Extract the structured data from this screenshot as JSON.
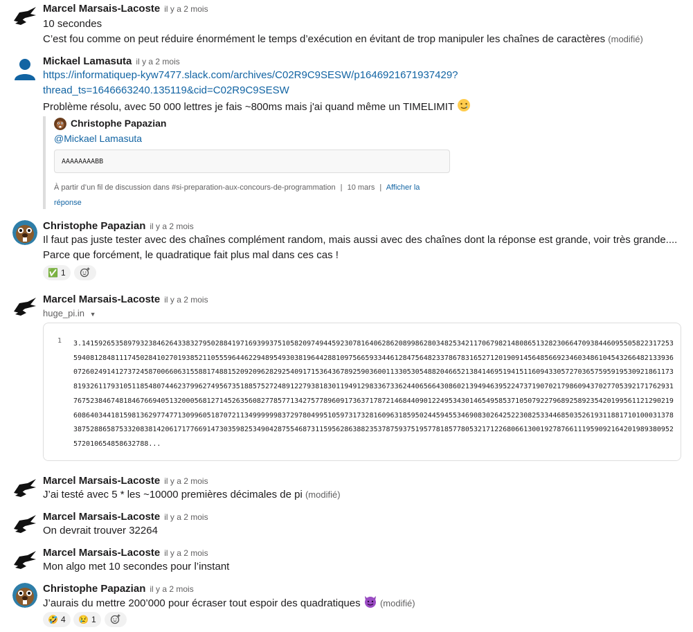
{
  "messages": [
    {
      "author": "Marcel Marsais-Lacoste",
      "time": "il y a 2 mois",
      "lines": [
        "10 secondes",
        "C’est fou comme on peut réduire énormément le temps d’exécution en évitant de trop manipuler les chaînes de caractères"
      ],
      "edited": "(modifié)"
    },
    {
      "author": "Mickael Lamasuta",
      "time": "il y a 2 mois",
      "link_line1": "https://informatiquep-kyw7477.slack.com/archives/C02R9C9SESW/p1646921671937429?",
      "link_line2": "thread_ts=1646663240.135119&cid=C02R9C9SESW",
      "text": "Problème résolu, avec 50 000 lettres je fais ~800ms mais j'ai quand même un TIMELIMIT",
      "quote": {
        "author": "Christophe Papazian",
        "mention": "@Mickael Lamasuta",
        "code": "AAAAAAAABB",
        "footer_prefix": "À partir d’un fil de discussion dans #si-preparation-aux-concours-de-programmation",
        "footer_sep": "|",
        "footer_date": "10 mars",
        "footer_link": "Afficher la",
        "footer_link2": "réponse"
      }
    },
    {
      "author": "Christophe Papazian",
      "time": "il y a 2 mois",
      "lines": [
        "Il faut pas juste tester avec des chaînes complément random, mais aussi avec des chaînes dont la réponse est grande, voir très grande....",
        "Parce que forcément, le quadratique fait plus mal dans ces cas !"
      ],
      "reactions": [
        {
          "emoji": "✅",
          "count": "1"
        }
      ]
    },
    {
      "author": "Marcel Marsais-Lacoste",
      "time": "il y a 2 mois",
      "file_name": "huge_pi.in",
      "file_line_number": "1",
      "file_content": "3.1415926535897932384626433832795028841971693993751058209749445923078164062862089986280348253421170679821480865132823066470938446095505822317253594081284811174502841027019385211055596446229489549303819644288109756659334461284756482337867831652712019091456485669234603486104543266482133936072602491412737245870066063155881748815209209628292540917153643678925903600113305305488204665213841469519415116094330572703657595919530921861173819326117931051185480744623799627495673518857527248912279381830119491298336733624406566430860213949463952247371907021798609437027705392171762931767523846748184676694051320005681271452635608277857713427577896091736371787214684409012249534301465495853710507922796892589235420199561121290219608640344181598136297747713099605187072113499999983729780499510597317328160963185950244594553469083026425223082533446850352619311881710100031378387528865875332083814206171776691473035982534904287554687311595628638823537875937519577818577805321712268066130019278766111959092164201989380952572010654858632788..."
    },
    {
      "author": "Marcel Marsais-Lacoste",
      "time": "il y a 2 mois",
      "lines": [
        "J’ai testé avec 5 * les ~10000 premières décimales de pi"
      ],
      "edited": "(modifié)"
    },
    {
      "author": "Marcel Marsais-Lacoste",
      "time": "il y a 2 mois",
      "lines": [
        "On devrait trouver 32264"
      ]
    },
    {
      "author": "Marcel Marsais-Lacoste",
      "time": "il y a 2 mois",
      "lines": [
        "Mon algo met 10 secondes pour l’instant"
      ]
    },
    {
      "author": "Christophe Papazian",
      "time": "il y a 2 mois",
      "lines": [
        "J’aurais du mettre 200’000 pour écraser tout espoir des quadratiques"
      ],
      "edited": "(modifié)",
      "reactions": [
        {
          "emoji": "🤣",
          "count": "4"
        },
        {
          "emoji": "😢",
          "count": "1"
        }
      ]
    }
  ]
}
